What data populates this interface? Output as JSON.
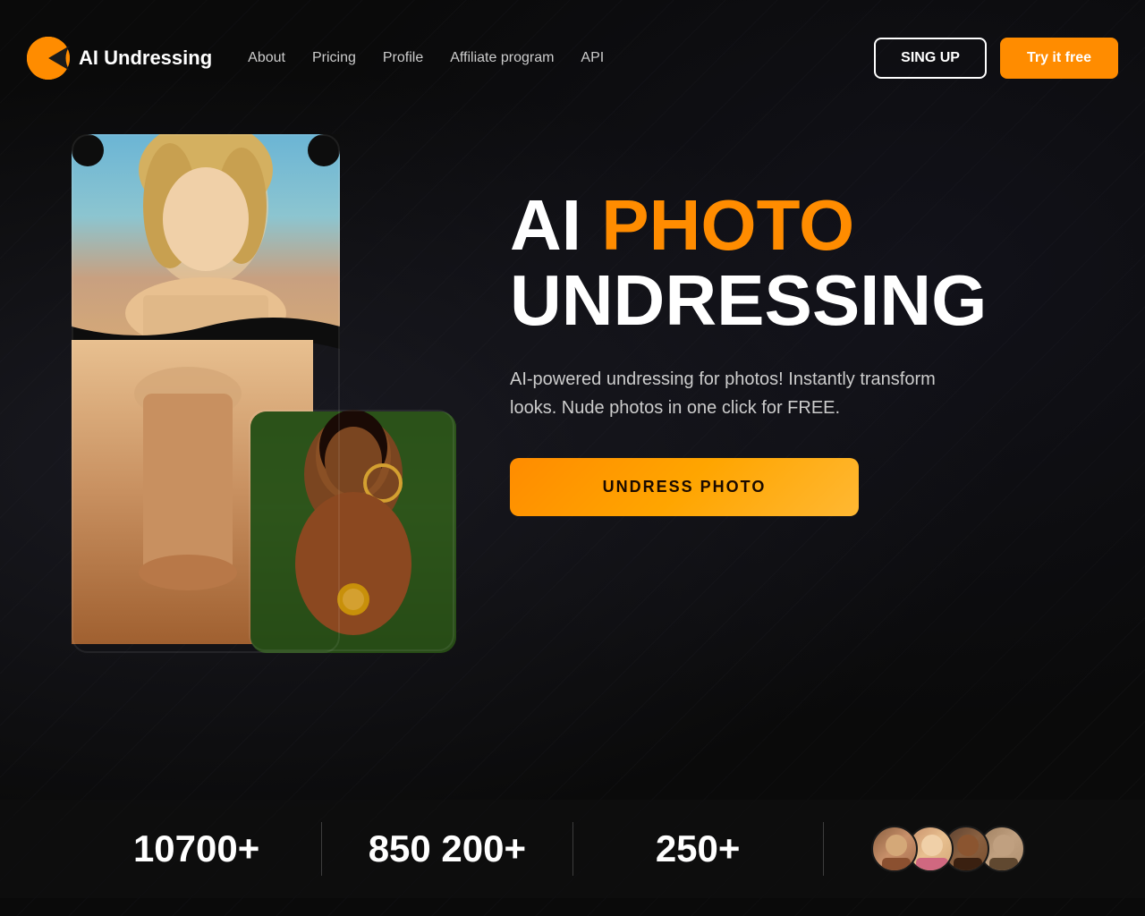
{
  "logo": {
    "text": "AI Undressing"
  },
  "nav": {
    "links": [
      {
        "id": "about",
        "label": "About"
      },
      {
        "id": "pricing",
        "label": "Pricing"
      },
      {
        "id": "profile",
        "label": "Profile"
      },
      {
        "id": "affiliate",
        "label": "Affiliate program"
      },
      {
        "id": "api",
        "label": "API"
      }
    ],
    "signup_label": "SING UP",
    "try_label": "Try it free"
  },
  "hero": {
    "title_ai": "AI ",
    "title_photo": "PHOTO",
    "title_undressing": "UNDRESSING",
    "description": "AI-powered undressing for photos! Instantly transform looks. Nude photos in one click for FREE.",
    "cta_label": "UNDRESS PHOTO"
  },
  "stats": [
    {
      "id": "stat1",
      "value": "10700+"
    },
    {
      "id": "stat2",
      "value": "850 200+"
    },
    {
      "id": "stat3",
      "value": "250+"
    }
  ]
}
